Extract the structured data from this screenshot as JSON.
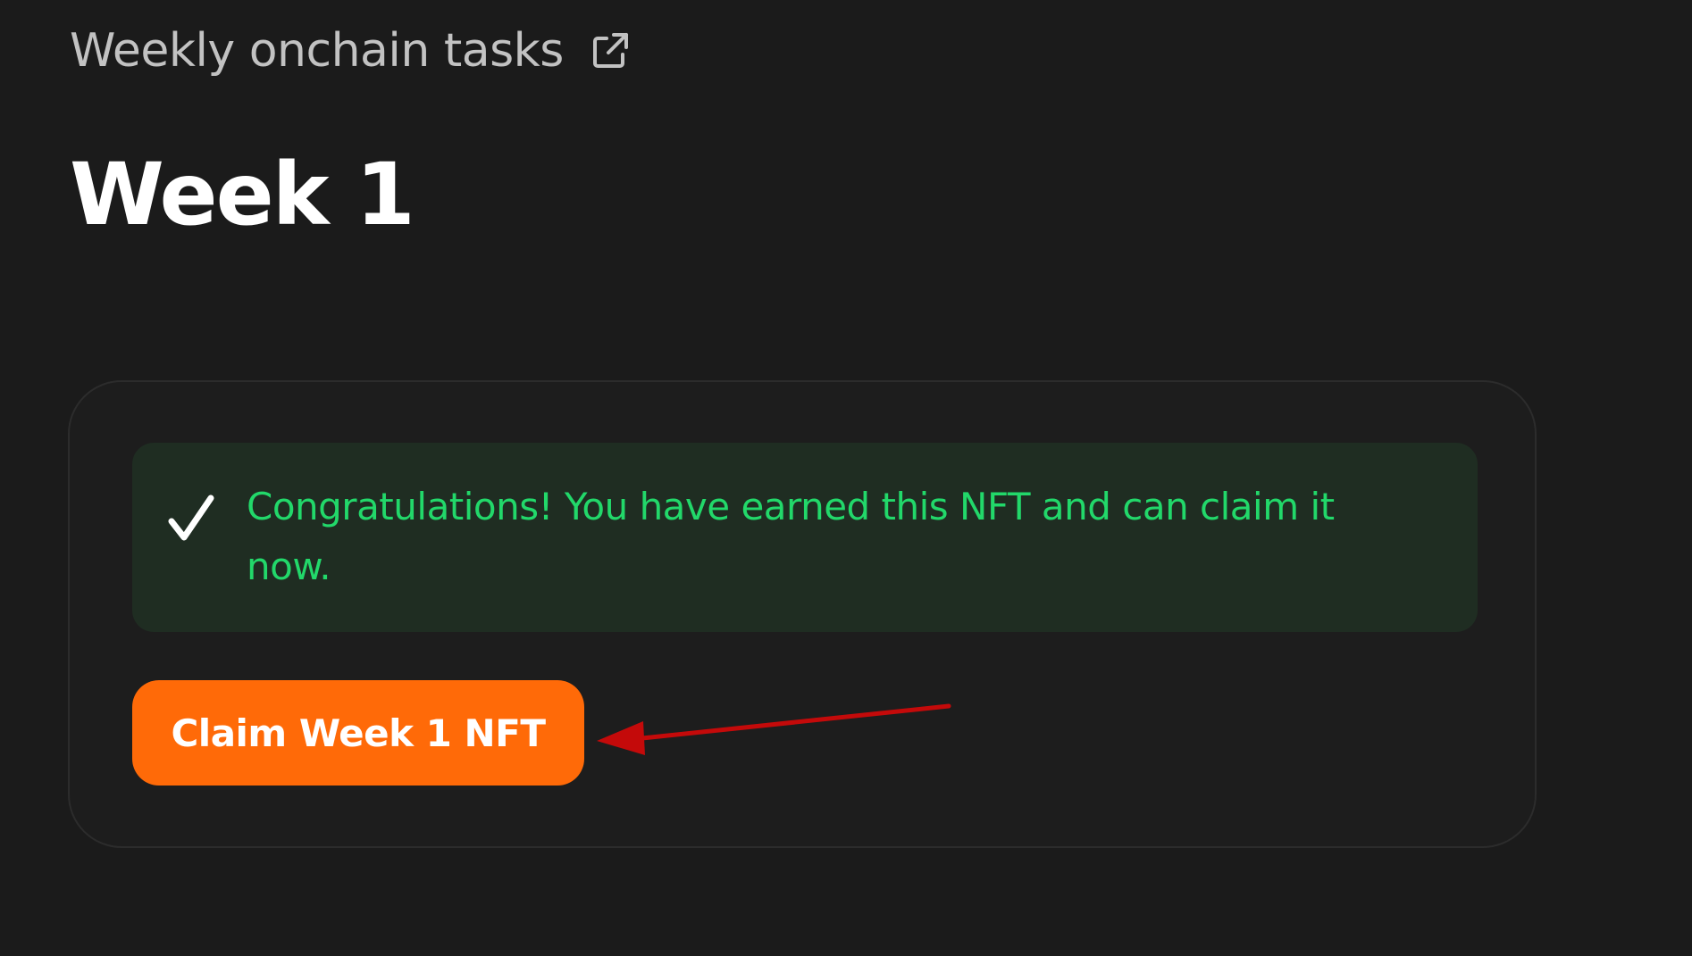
{
  "header": {
    "title": "Weekly onchain tasks",
    "link_icon": "external-link-icon"
  },
  "week": {
    "title": "Week 1"
  },
  "card": {
    "success_message": {
      "icon": "checkmark-icon",
      "text": "Congratulations! You have earned this NFT and can claim it now."
    },
    "claim_button_label": "Claim Week 1 NFT"
  },
  "annotation": {
    "type": "arrow",
    "points_to": "claim-button",
    "color": "#c40a0a"
  },
  "colors": {
    "background": "#1b1b1b",
    "card_background": "#1d1d1d",
    "success_background": "#1f2d22",
    "success_text": "#22d86a",
    "accent": "#ff6a08",
    "title": "#ffffff",
    "subtitle": "#c2c2c2"
  }
}
